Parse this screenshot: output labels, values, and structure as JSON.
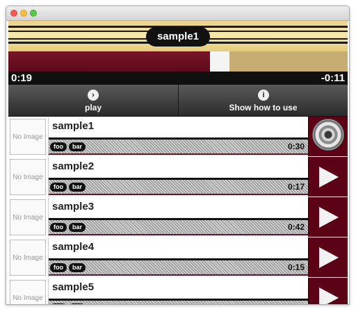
{
  "window": {
    "title_pill": "sample1"
  },
  "player": {
    "elapsed": "0:19",
    "remaining": "-0:11",
    "progress_fraction": 0.63
  },
  "toolbar": {
    "play": {
      "label": "play",
      "icon": "chevron-right-icon",
      "glyph": "›"
    },
    "help": {
      "label": "Show how to use",
      "icon": "info-icon",
      "glyph": "i"
    }
  },
  "list": {
    "thumb_text": "No Image",
    "items": [
      {
        "title": "sample1",
        "tags": [
          "foo",
          "bar"
        ],
        "duration": "0:30",
        "state": "playing"
      },
      {
        "title": "sample2",
        "tags": [
          "foo",
          "bar"
        ],
        "duration": "0:17",
        "state": "idle"
      },
      {
        "title": "sample3",
        "tags": [
          "foo",
          "bar"
        ],
        "duration": "0:42",
        "state": "idle"
      },
      {
        "title": "sample4",
        "tags": [
          "foo",
          "bar"
        ],
        "duration": "0:15",
        "state": "idle"
      },
      {
        "title": "sample5",
        "tags": [
          "foo",
          "bar"
        ],
        "duration": "",
        "state": "idle"
      }
    ]
  },
  "colors": {
    "accent_maroon": "#5c0217",
    "header_gold": "#f6e7aa",
    "progress_played": "#7a1428",
    "progress_remaining": "#c7ad72"
  }
}
